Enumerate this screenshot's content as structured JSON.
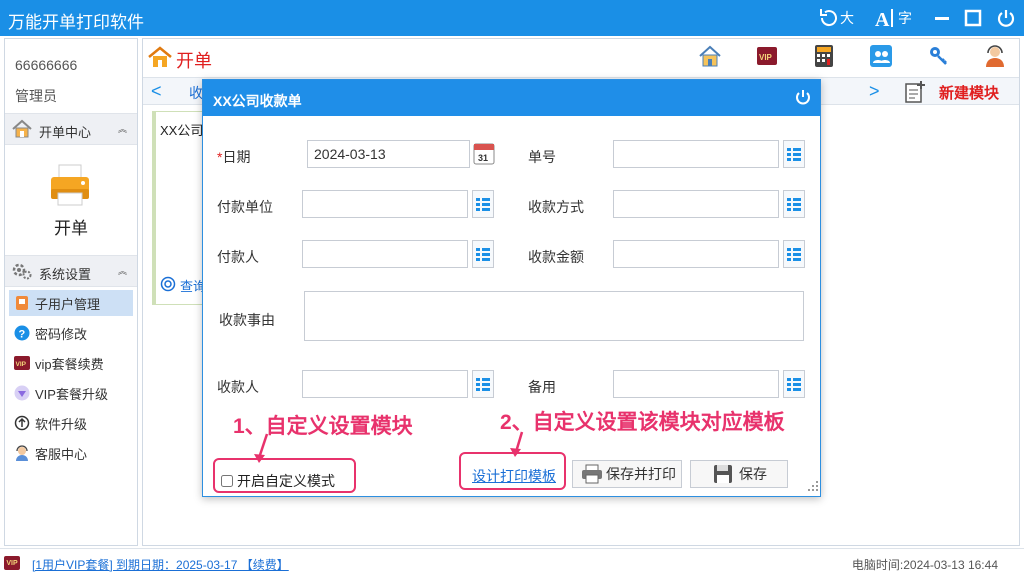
{
  "window": {
    "title": "万能开单打印软件",
    "font_large": "大",
    "font_label": "字"
  },
  "sidebar": {
    "user_id": "66666666",
    "role": "管理员",
    "section_billing": "开单中心",
    "billing_item": "开单",
    "section_settings": "系统设置",
    "items": [
      {
        "label": "子用户管理",
        "icon": "user-card-icon"
      },
      {
        "label": "密码修改",
        "icon": "question-icon"
      },
      {
        "label": "vip套餐续费",
        "icon": "vip-icon"
      },
      {
        "label": "VIP套餐升级",
        "icon": "diamond-icon"
      },
      {
        "label": "软件升级",
        "icon": "upgrade-icon"
      },
      {
        "label": "客服中心",
        "icon": "service-icon"
      }
    ]
  },
  "main": {
    "title": "开单",
    "tab_partial": "收",
    "new_template": "新建模块",
    "card_text": "XX公司",
    "query_partial": "查询"
  },
  "dialog": {
    "title": "XX公司收款单",
    "fields": {
      "date_label": "日期",
      "date_value": "2024-03-13",
      "calendar_day": "31",
      "number_label": "单号",
      "payer_unit_label": "付款单位",
      "pay_method_label": "收款方式",
      "payer_label": "付款人",
      "amount_label": "收款金额",
      "reason_label": "收款事由",
      "receiver_label": "收款人",
      "remark_label": "备用"
    },
    "custom_mode_label": "开启自定义模式",
    "design_link": "设计打印模板",
    "save_print": "保存并打印",
    "save": "保存"
  },
  "annotations": {
    "a1": "1、自定义设置模块",
    "a2": "2、自定义设置该模块对应模板"
  },
  "footer": {
    "vip_badge": "VIP",
    "vip_text": "[1用户VIP套餐] 到期日期：2025-03-17 【续费】",
    "clock": "电脑时间:2024-03-13 16:44"
  },
  "colors": {
    "accent": "#1a8fe6",
    "title_red": "#e02020",
    "annotation": "#e8326c"
  }
}
